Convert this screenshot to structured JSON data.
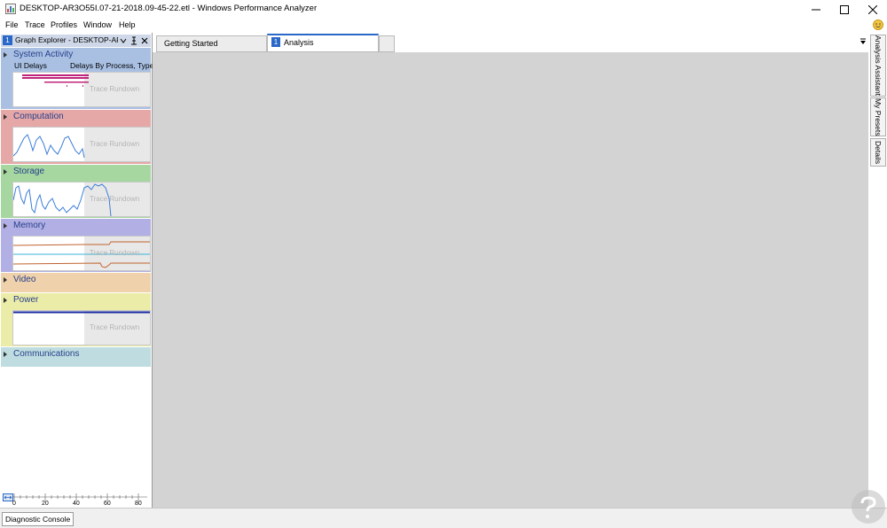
{
  "window": {
    "title": "DESKTOP-AR3O55I.07-21-2018.09-45-22.etl - Windows Performance Analyzer",
    "minimize_icon": "minimize-icon",
    "maximize_icon": "maximize-icon",
    "close_icon": "close-icon"
  },
  "menu": [
    "File",
    "Trace",
    "Profiles",
    "Window",
    "Help"
  ],
  "graph_explorer": {
    "number": "1",
    "title": "Graph Explorer - DESKTOP-AR...",
    "categories": [
      {
        "name": "System Activity",
        "color": "#a9c0e3",
        "sub_left": "UI Delays",
        "sub_right": "Delays By Process, Type",
        "overlay": "Trace Rundown"
      },
      {
        "name": "Computation",
        "color": "#e6a7a7",
        "overlay": "Trace Rundown"
      },
      {
        "name": "Storage",
        "color": "#a6d7a0",
        "overlay": "Trace Rundown"
      },
      {
        "name": "Memory",
        "color": "#b1afe4",
        "overlay": "Trace Rundown"
      },
      {
        "name": "Video",
        "color": "#efd2ab"
      },
      {
        "name": "Power",
        "color": "#ececa9",
        "overlay": "Trace Rundown"
      },
      {
        "name": "Communications",
        "color": "#bfdde0"
      }
    ],
    "ruler_ticks": [
      "0",
      "20",
      "40",
      "60",
      "80"
    ]
  },
  "tabs": [
    {
      "label": "Getting Started"
    },
    {
      "number": "1",
      "label": "Analysis"
    }
  ],
  "right_tabs": [
    "Analysis Assistant",
    "My Presets",
    "Details"
  ],
  "status": {
    "diagnostic_console": "Diagnostic Console"
  }
}
